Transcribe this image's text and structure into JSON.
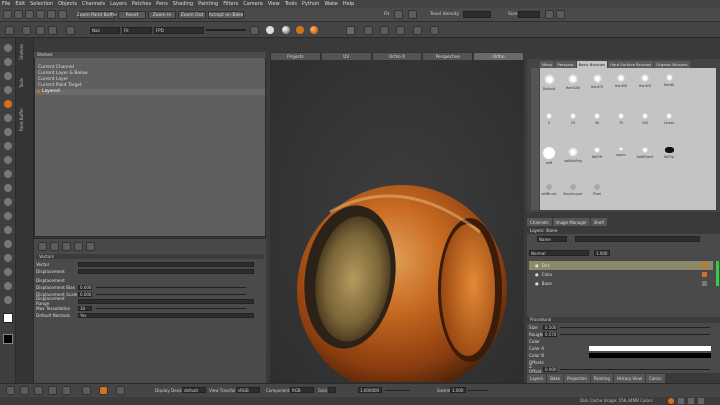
{
  "menu": [
    "File",
    "Edit",
    "Selection",
    "Objects",
    "Channels",
    "Layers",
    "Patches",
    "Pens",
    "Shading",
    "Painting",
    "Filters",
    "Camera",
    "View",
    "Tools",
    "Python",
    "Wake",
    "Help"
  ],
  "toolbar1": {
    "zoom_buffer": "Zoom Paint Buffer",
    "reset": "Reset",
    "zoom_in": "Zoom In",
    "zoom_out": "Zoom Out",
    "bake": "Accept on Bake",
    "fit_label": "Fit",
    "texel_label": "Texel density",
    "size_label": "Size"
  },
  "toolbar2": {
    "field1": "Nail",
    "field2": "Fit",
    "field3": "FPD"
  },
  "left_tabs": [
    "Shelves",
    "Tools",
    "Paint Buffer"
  ],
  "panel_header": "Shelves",
  "selection_items": [
    {
      "label": "Current Channel",
      "selected": false
    },
    {
      "label": "Current Layer & Below",
      "selected": false
    },
    {
      "label": "Current Layer",
      "selected": false
    },
    {
      "label": "Current Paint Target",
      "selected": false
    },
    {
      "label": "Layered",
      "selected": true
    }
  ],
  "props": {
    "section": "Vectors",
    "rows": [
      {
        "label": "Vector",
        "value": ""
      },
      {
        "label": "Displacement",
        "value": ""
      },
      {
        "label": "Displacement",
        "value": ""
      },
      {
        "label": "Displacement Bias",
        "value": "0.000"
      },
      {
        "label": "Displacement Scale",
        "value": "0.000"
      },
      {
        "label": "Displacement Range",
        "value": ""
      },
      {
        "label": "Max Tessellation",
        "value": "10"
      },
      {
        "label": "Default Normals",
        "value": "Yes"
      }
    ]
  },
  "viewport_tabs": [
    "Projects",
    "UV",
    "Ortho X",
    "Perspective",
    "Ortho"
  ],
  "shelf_tabs": [
    "Menu",
    "Personal",
    "Basic Brushes",
    "Hard Surface Brushes",
    "Organic Brushes"
  ],
  "brushes": [
    {
      "name": "Default"
    },
    {
      "name": "Hard100"
    },
    {
      "name": "Hard75"
    },
    {
      "name": "Hard50"
    },
    {
      "name": "Hard25"
    },
    {
      "name": "Hard0"
    },
    {
      "name": "0"
    },
    {
      "name": "25"
    },
    {
      "name": "50"
    },
    {
      "name": "75"
    },
    {
      "name": "100"
    },
    {
      "name": "Linear"
    },
    {
      "name": "soft"
    },
    {
      "name": "softAirPng"
    },
    {
      "name": "fallOff"
    },
    {
      "name": "warm"
    },
    {
      "name": "SoftDirect"
    },
    {
      "name": "fallTip"
    },
    {
      "name": "defBrush"
    },
    {
      "name": "BrushLayer"
    },
    {
      "name": "Pixel"
    }
  ],
  "mid_tabs": [
    "Channels",
    "Image Manager",
    "Shelf"
  ],
  "layers_header": "Layers: Stone",
  "layers_filter": "Name",
  "layers_mode": "Normal",
  "layers_opacity": "1.000",
  "layers": [
    {
      "name": "Dirt",
      "active": true
    },
    {
      "name": "Color",
      "active": false
    },
    {
      "name": "Base",
      "active": false
    }
  ],
  "procedural": {
    "title": "Procedural",
    "rows": [
      {
        "label": "Size",
        "value": "0.500"
      },
      {
        "label": "Roughness",
        "value": "0.570"
      },
      {
        "label": "Color",
        "value": ""
      },
      {
        "label": "Color A",
        "value": ""
      },
      {
        "label": "Color B",
        "value": ""
      },
      {
        "label": "Offsets",
        "value": ""
      },
      {
        "label": "Z Offset",
        "value": "0.000"
      }
    ]
  },
  "bottom_tabs": [
    "Layers",
    "Bake",
    "Projection",
    "Painting",
    "History View",
    "Colors"
  ],
  "bottombar": {
    "display_device": "Display Device",
    "display_val": "default",
    "view_transform": "View Transform",
    "view_val": "sRGB",
    "component": "Component",
    "component_val": "RGB",
    "gain": "Gain",
    "gain_val": "1.000000",
    "gamma": "Gamma",
    "gamma_val": "1.000"
  },
  "status": "Disk Cache Usage: 556.44MB Colors"
}
